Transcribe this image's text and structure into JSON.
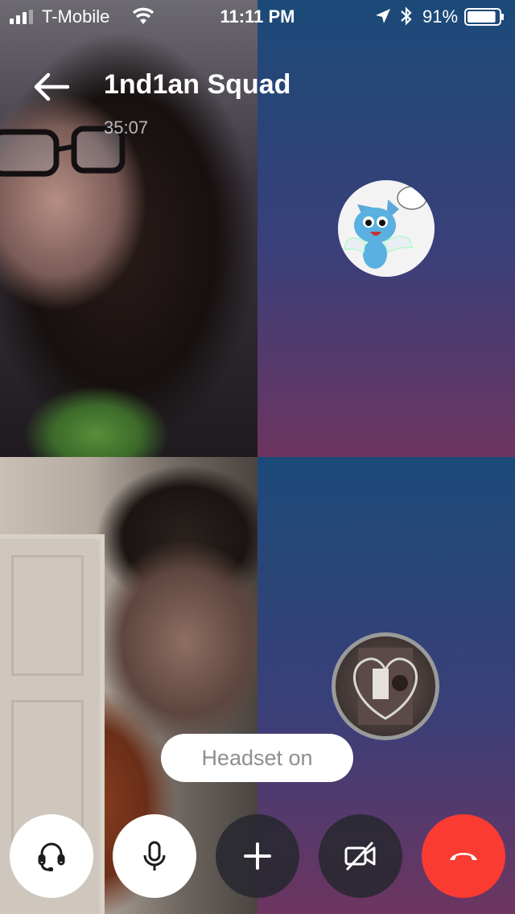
{
  "status_bar": {
    "carrier": "T-Mobile",
    "time": "11:11 PM",
    "battery_percent": "91%",
    "battery_level": 0.91,
    "signal_bars": 3,
    "icons": [
      "signal-icon",
      "wifi-icon",
      "location-icon",
      "bluetooth-icon",
      "battery-icon"
    ]
  },
  "header": {
    "back_icon": "back-arrow-icon",
    "title": "1nd1an Squad",
    "duration": "35:07"
  },
  "participants": [
    {
      "tile": "top-left",
      "kind": "video-feed"
    },
    {
      "tile": "top-right",
      "kind": "avatar",
      "avatar_icon": "cartoon-cat-avatar"
    },
    {
      "tile": "bottom-left",
      "kind": "video-feed"
    },
    {
      "tile": "bottom-right",
      "kind": "avatar",
      "avatar_icon": "photo-avatar"
    }
  ],
  "toast": {
    "text": "Headset on"
  },
  "controls": [
    {
      "name": "headset-button",
      "icon": "headset-icon",
      "active": true
    },
    {
      "name": "mute-button",
      "icon": "microphone-icon",
      "active": true
    },
    {
      "name": "add-participant-button",
      "icon": "plus-icon",
      "active": false
    },
    {
      "name": "video-toggle-button",
      "icon": "video-off-icon",
      "active": false
    },
    {
      "name": "end-call-button",
      "icon": "hang-up-icon",
      "active": false
    }
  ],
  "colors": {
    "end_call": "#f93b32",
    "control_dark": "#28282f",
    "control_light": "#ffffff",
    "gradient_top": "#1b4a78",
    "gradient_bottom": "#6d3560",
    "toast_text": "#8e8e93"
  }
}
